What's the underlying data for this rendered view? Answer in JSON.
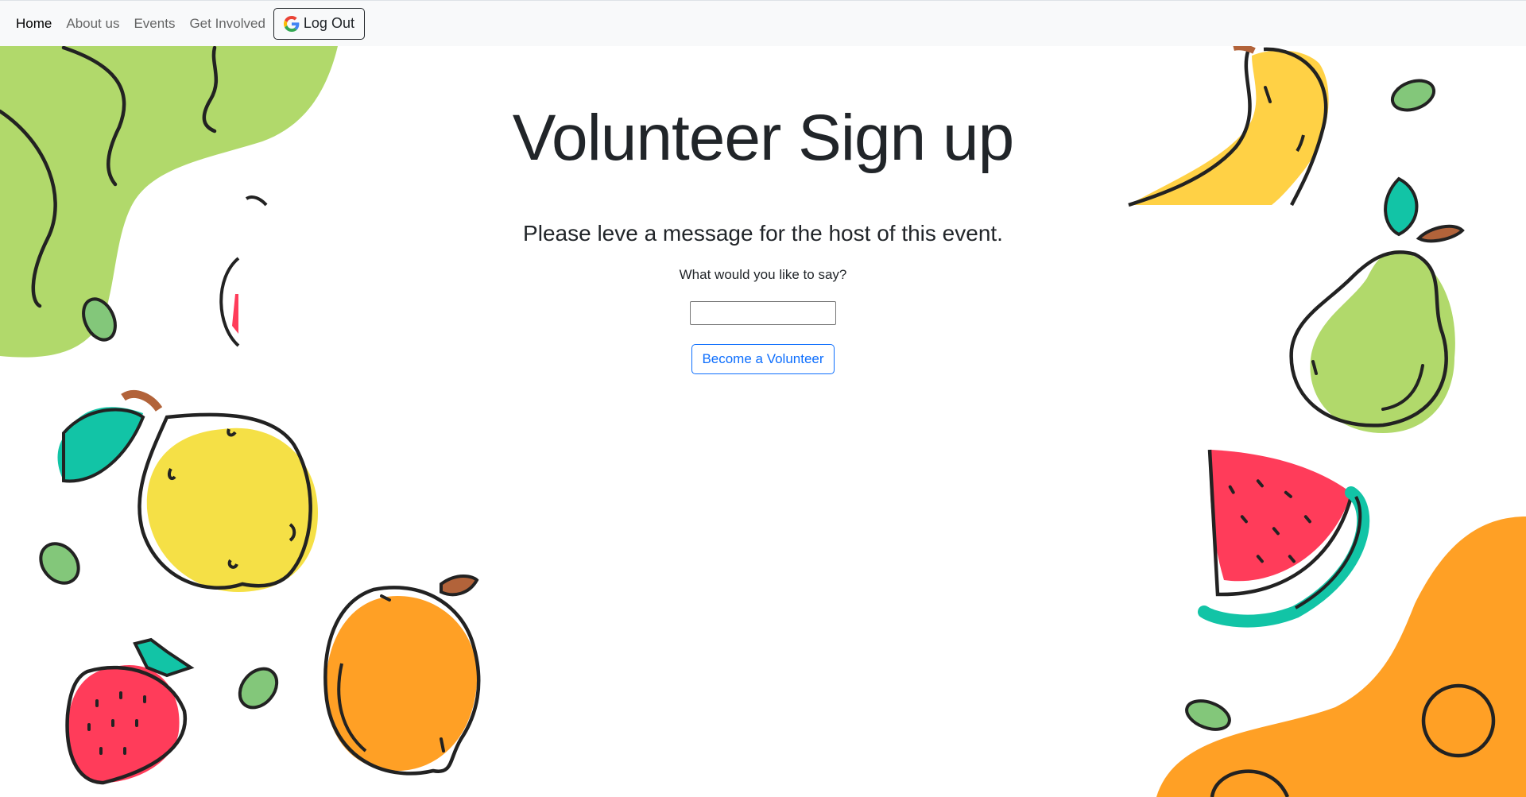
{
  "nav": {
    "items": [
      {
        "label": "Home",
        "active": true
      },
      {
        "label": "About us",
        "active": false
      },
      {
        "label": "Events",
        "active": false
      },
      {
        "label": "Get Involved",
        "active": false
      }
    ],
    "logout_label": "Log Out",
    "logout_icon": "google-icon"
  },
  "main": {
    "title": "Volunteer Sign up",
    "subtitle": "Please leve a message for the host of this event.",
    "prompt": "What would you like to say?",
    "message_value": "",
    "submit_label": "Become a Volunteer"
  },
  "colors": {
    "primary": "#0d6efd",
    "navbar_bg": "#f8f9fa",
    "text": "#212529",
    "green_blob": "#b1d96b",
    "orange_blob": "#ffa025",
    "banana": "#ffd145",
    "lemon": "#f5e046",
    "teal_leaf": "#12c4a6",
    "strawberry": "#ff3c5a",
    "pear": "#b1d96b",
    "stem_brown": "#b2633a"
  }
}
